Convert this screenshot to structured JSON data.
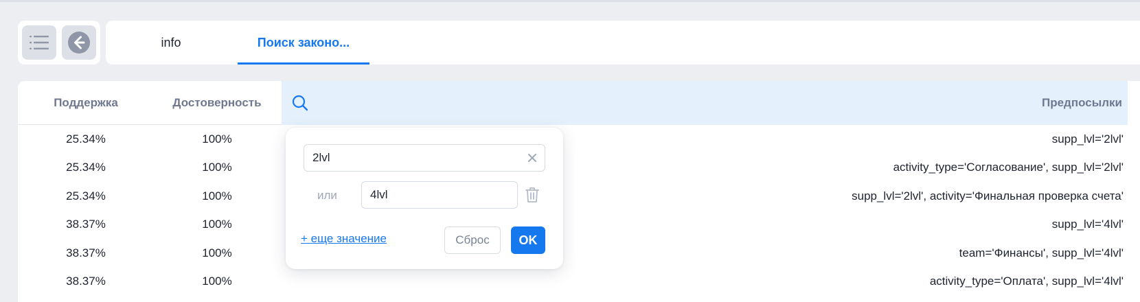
{
  "toolbar": {
    "menu_icon": "list-menu-icon",
    "back_icon": "arrow-left-circle-icon"
  },
  "tabs": [
    {
      "label": "info",
      "active": false
    },
    {
      "label": "Поиск законо...",
      "active": true
    }
  ],
  "colors": {
    "accent": "#1678ef",
    "header_text": "#6f7890",
    "filter_header_bg": "#e4f1fd",
    "page_bg": "#eceef2"
  },
  "table": {
    "headers": {
      "support": "Поддержка",
      "confidence": "Достоверность",
      "filter_icon": "search-icon",
      "premises": "Предпосылки"
    },
    "rows": [
      {
        "support": "25.34%",
        "confidence": "100%",
        "premise": "supp_lvl='2lvl'"
      },
      {
        "support": "25.34%",
        "confidence": "100%",
        "premise": "activity_type='Согласование', supp_lvl='2lvl'"
      },
      {
        "support": "25.34%",
        "confidence": "100%",
        "premise": "supp_lvl='2lvl', activity='Финальная проверка счета'"
      },
      {
        "support": "38.37%",
        "confidence": "100%",
        "premise": "supp_lvl='4lvl'"
      },
      {
        "support": "38.37%",
        "confidence": "100%",
        "premise": "team='Финансы', supp_lvl='4lvl'"
      },
      {
        "support": "38.37%",
        "confidence": "100%",
        "premise": "activity_type='Оплата', supp_lvl='4lvl'"
      }
    ]
  },
  "filter_popup": {
    "value1": "2lvl",
    "or_label": "или",
    "value2": "4lvl",
    "add_value_link": "+ еще значение",
    "reset_label": "Сброс",
    "ok_label": "OK"
  }
}
